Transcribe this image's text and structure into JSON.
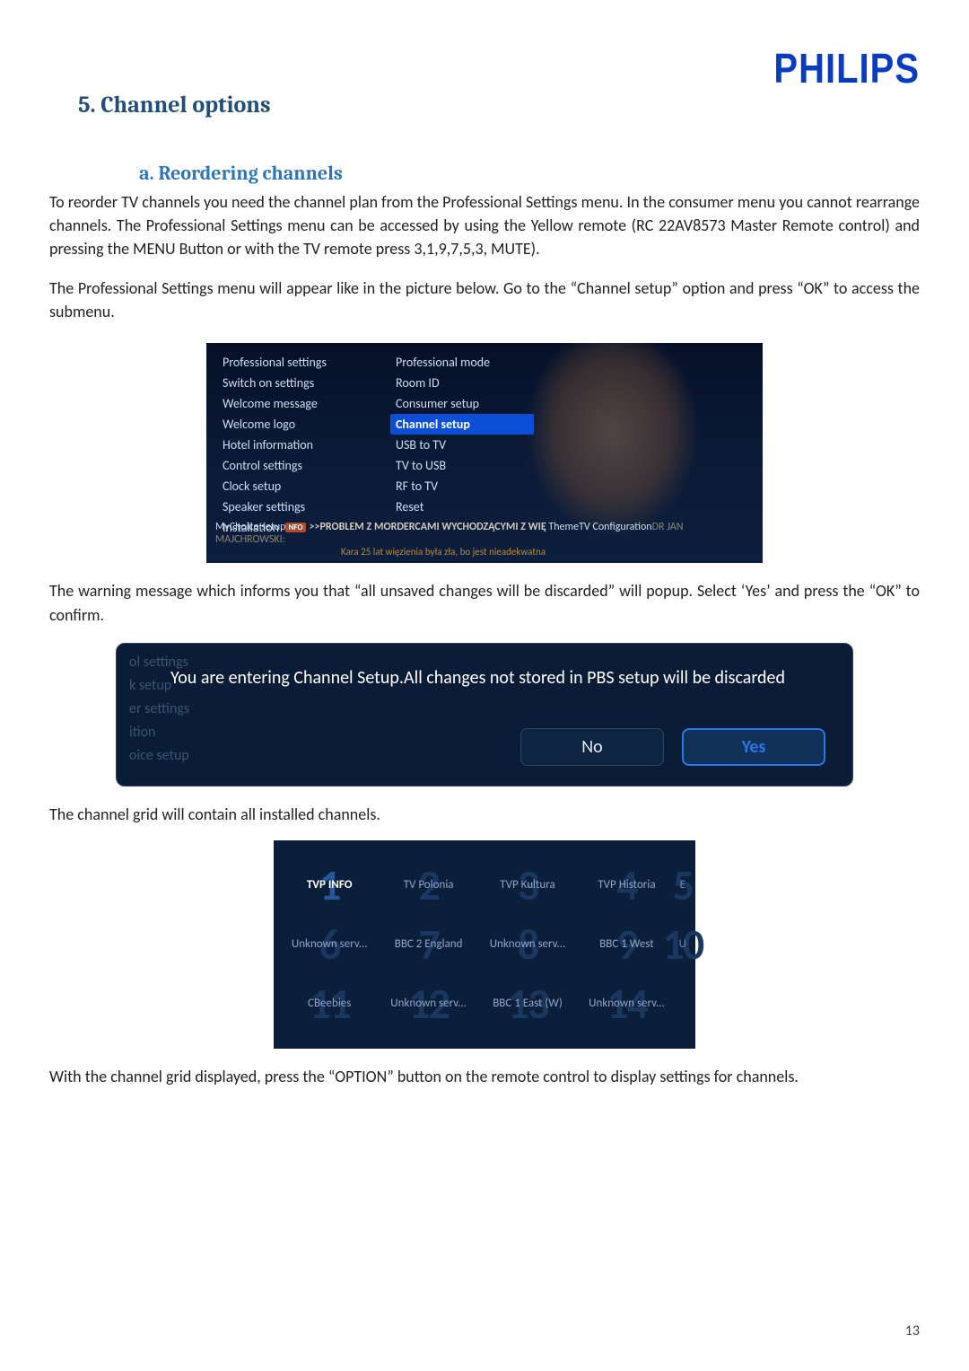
{
  "brand": "PHILIPS",
  "page_number": "13",
  "heading_section": "5.  Channel options",
  "heading_sub": "a.  Reordering channels",
  "para1": "To reorder TV channels you need the channel plan from the Professional Settings menu. In the consumer menu you cannot rearrange channels.  The Professional Settings menu can be accessed by using the Yellow remote (RC 22AV8573 Master Remote control) and pressing the MENU Button or with the TV remote press 3,1,9,7,5,3, MUTE).",
  "para2": "The Professional Settings menu will appear like in the picture below. Go to the “Channel setup” option and press “OK” to access the submenu.",
  "para3": "The warning message which informs you that “all unsaved changes will be discarded” will popup. Select ‘Yes’ and press the “OK” to confirm.",
  "para4": "The channel grid will contain all installed channels.",
  "para5": "With the channel grid displayed, press the “OPTION” button on the remote control to display settings for channels.",
  "shot1": {
    "left": [
      "Professional settings",
      "Switch on settings",
      "Welcome message",
      "Welcome logo",
      "Hotel information",
      "Control settings",
      "Clock setup",
      "Speaker settings",
      "Installation",
      "MyChoice setup",
      "ThemeTV Configuration"
    ],
    "right": [
      "Professional mode",
      "Room ID",
      "Consumer setup",
      "Channel setup",
      "USB to TV",
      "TV to USB",
      "RF to TV",
      "Reset"
    ],
    "right_selected_index": 3,
    "ticker_badge": "NFO",
    "ticker1": ">>PROBLEM Z MORDERCAMI WYCHODZĄCYMI Z WIĘ",
    "ticker2": "DR JAN MAJCHROWSKI:",
    "ticker3": "Kara 25 lat więzienia była zła, bo jest nieadekwatna"
  },
  "shot2": {
    "ghost": [
      "ol settings",
      "k setup",
      "er settings",
      "ition",
      "oice setup"
    ],
    "message": "You are entering Channel Setup.All changes not stored in PBS setup will be discarded",
    "no": "No",
    "yes": "Yes"
  },
  "shot3": {
    "cells": [
      [
        {
          "n": "1",
          "t": "TVP INFO",
          "sel": true
        },
        {
          "n": "2",
          "t": "TV Polonia"
        },
        {
          "n": "3",
          "t": "TVP Kultura"
        },
        {
          "n": "4",
          "t": "TVP Historia"
        },
        {
          "n": "5",
          "t": "E",
          "edge": true
        }
      ],
      [
        {
          "n": "6",
          "t": "Unknown serv..."
        },
        {
          "n": "7",
          "t": "BBC 2 England"
        },
        {
          "n": "8",
          "t": "Unknown serv..."
        },
        {
          "n": "9",
          "t": "BBC 1 West"
        },
        {
          "n": "10",
          "t": "U",
          "edge": true
        }
      ],
      [
        {
          "n": "11",
          "t": "CBeebies"
        },
        {
          "n": "12",
          "t": "Unknown serv..."
        },
        {
          "n": "13",
          "t": "BBC 1 East (W)"
        },
        {
          "n": "14",
          "t": "Unknown serv..."
        },
        {
          "n": "",
          "t": "",
          "edge": true
        }
      ]
    ]
  }
}
